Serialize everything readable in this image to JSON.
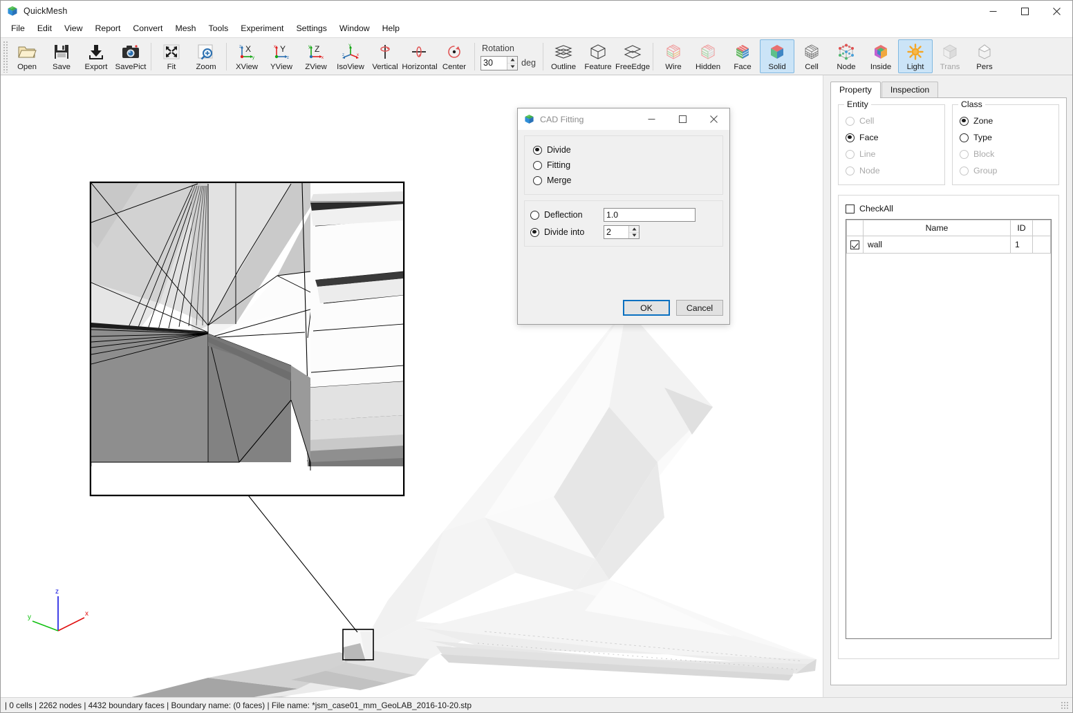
{
  "window": {
    "title": "QuickMesh",
    "icon": "app-cube-icon",
    "minimize": "—",
    "maximize": "☐",
    "close": "✕"
  },
  "menubar": {
    "items": [
      {
        "label": "File"
      },
      {
        "label": "Edit"
      },
      {
        "label": "View"
      },
      {
        "label": "Report"
      },
      {
        "label": "Convert"
      },
      {
        "label": "Mesh"
      },
      {
        "label": "Tools"
      },
      {
        "label": "Experiment"
      },
      {
        "label": "Settings"
      },
      {
        "label": "Window"
      },
      {
        "label": "Help"
      }
    ]
  },
  "toolbar": {
    "groups": [
      {
        "buttons": [
          {
            "label": "Open",
            "icon": "folder-open-icon",
            "state": "normal"
          },
          {
            "label": "Save",
            "icon": "floppy-disk-icon",
            "state": "normal"
          },
          {
            "label": "Export",
            "icon": "download-arrow-icon",
            "state": "normal"
          },
          {
            "label": "SavePict",
            "icon": "camera-icon",
            "state": "normal"
          }
        ]
      },
      {
        "buttons": [
          {
            "label": "Fit",
            "icon": "fit-arrows-icon",
            "state": "normal"
          },
          {
            "label": "Zoom",
            "icon": "magnifier-plus-icon",
            "state": "normal"
          }
        ]
      },
      {
        "buttons": [
          {
            "label": "XView",
            "icon": "axis-x-view-icon",
            "state": "normal"
          },
          {
            "label": "YView",
            "icon": "axis-y-view-icon",
            "state": "normal"
          },
          {
            "label": "ZView",
            "icon": "axis-z-view-icon",
            "state": "normal"
          },
          {
            "label": "IsoView",
            "icon": "axis-iso-view-icon",
            "state": "normal"
          },
          {
            "label": "Vertical",
            "icon": "rotate-vertical-icon",
            "state": "normal"
          },
          {
            "label": "Horizontal",
            "icon": "rotate-horizontal-icon",
            "state": "normal"
          },
          {
            "label": "Center",
            "icon": "rotate-center-icon",
            "state": "normal"
          }
        ]
      },
      {
        "buttons": [
          {
            "label": "Outline",
            "icon": "outline-layers-icon",
            "state": "normal"
          },
          {
            "label": "Feature",
            "icon": "feature-cube-icon",
            "state": "normal"
          },
          {
            "label": "FreeEdge",
            "icon": "freeedge-icon",
            "state": "normal"
          }
        ]
      },
      {
        "buttons": [
          {
            "label": "Wire",
            "icon": "wire-cube-icon",
            "state": "normal"
          },
          {
            "label": "Hidden",
            "icon": "hidden-cube-icon",
            "state": "normal"
          },
          {
            "label": "Face",
            "icon": "face-cube-icon",
            "state": "normal"
          },
          {
            "label": "Solid",
            "icon": "solid-cube-icon",
            "state": "active"
          },
          {
            "label": "Cell",
            "icon": "cell-grid-icon",
            "state": "normal"
          },
          {
            "label": "Node",
            "icon": "node-dots-icon",
            "state": "normal"
          },
          {
            "label": "Inside",
            "icon": "inside-cube-icon",
            "state": "normal"
          },
          {
            "label": "Light",
            "icon": "sun-light-icon",
            "state": "active"
          },
          {
            "label": "Trans",
            "icon": "transparent-cube-icon",
            "state": "disabled"
          },
          {
            "label": "Pers",
            "icon": "perspective-icon",
            "state": "normal"
          }
        ]
      }
    ],
    "rotation": {
      "label": "Rotation",
      "value": "30",
      "unit": "deg",
      "up": "▲",
      "down": "▼"
    }
  },
  "viewport": {
    "axis_gizmo": {
      "x_label": "x",
      "y_label": "y",
      "z_label": "z",
      "x_color": "#e01010",
      "y_color": "#10c010",
      "z_color": "#1010e0"
    },
    "detail_inset_label": "zoom-detail-inset"
  },
  "right_panel": {
    "tabs": [
      {
        "label": "Property",
        "active": true
      },
      {
        "label": "Inspection",
        "active": false
      }
    ],
    "entity_group": {
      "title": "Entity",
      "options": [
        {
          "label": "Cell",
          "selected": false,
          "disabled": true
        },
        {
          "label": "Face",
          "selected": true,
          "disabled": false
        },
        {
          "label": "Line",
          "selected": false,
          "disabled": true
        },
        {
          "label": "Node",
          "selected": false,
          "disabled": true
        }
      ]
    },
    "class_group": {
      "title": "Class",
      "options": [
        {
          "label": "Zone",
          "selected": true,
          "disabled": false
        },
        {
          "label": "Type",
          "selected": false,
          "disabled": false
        },
        {
          "label": "Block",
          "selected": false,
          "disabled": true
        },
        {
          "label": "Group",
          "selected": false,
          "disabled": true
        }
      ]
    },
    "check_all": {
      "label": "CheckAll",
      "checked": false
    },
    "table": {
      "headers": [
        "",
        "Name",
        "ID",
        ""
      ],
      "rows": [
        {
          "checked": true,
          "name": "wall",
          "id": "1"
        }
      ]
    }
  },
  "dialog": {
    "title": "CAD Fitting",
    "icon": "app-cube-icon",
    "minimize": "—",
    "maximize": "☐",
    "close": "✕",
    "mode_options": [
      {
        "label": "Divide",
        "selected": true
      },
      {
        "label": "Fitting",
        "selected": false
      },
      {
        "label": "Merge",
        "selected": false
      }
    ],
    "param_options": [
      {
        "label": "Deflection",
        "selected": false,
        "value": "1.0",
        "type": "text"
      },
      {
        "label": "Divide into",
        "selected": true,
        "value": "2",
        "type": "spin"
      }
    ],
    "ok_label": "OK",
    "cancel_label": "Cancel"
  },
  "statusbar": {
    "text": "| 0 cells | 2262 nodes | 4432 boundary faces |  Boundary name:  (0 faces) | File name: *jsm_case01_mm_GeoLAB_2016-10-20.stp"
  }
}
